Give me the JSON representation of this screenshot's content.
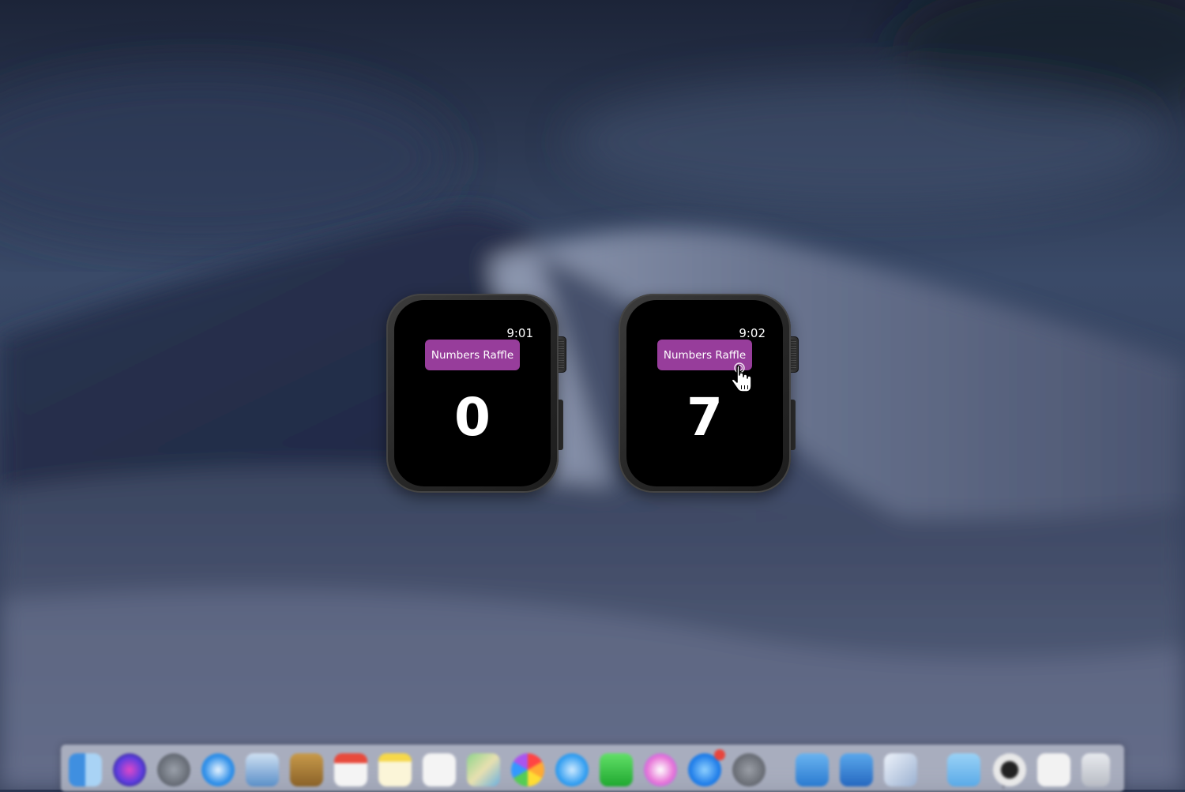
{
  "watches": [
    {
      "time": "9:01",
      "button_label": "Numbers Raffle",
      "number": "0"
    },
    {
      "time": "9:02",
      "button_label": "Numbers Raffle",
      "number": "7"
    }
  ],
  "colors": {
    "raffle_button": "#973d9b",
    "screen": "#000000",
    "number_text": "#ffffff"
  },
  "cursor": {
    "icon": "hand-pointer-icon"
  },
  "dock": {
    "icons": [
      "finder-icon",
      "siri-icon",
      "launchpad-icon",
      "safari-icon",
      "preview-icon",
      "notes-book-icon",
      "calendar-icon",
      "notes-icon",
      "reminders-icon",
      "maps-icon",
      "photos-icon",
      "messages-icon",
      "facetime-icon",
      "itunes-icon",
      "app-store-icon",
      "system-preferences-icon",
      "xcode-simulator-icon",
      "finder-folder-icon",
      "xcode-icon",
      "downloads-folder-icon",
      "activity-icon",
      "preview-window-icon",
      "trash-icon"
    ]
  }
}
